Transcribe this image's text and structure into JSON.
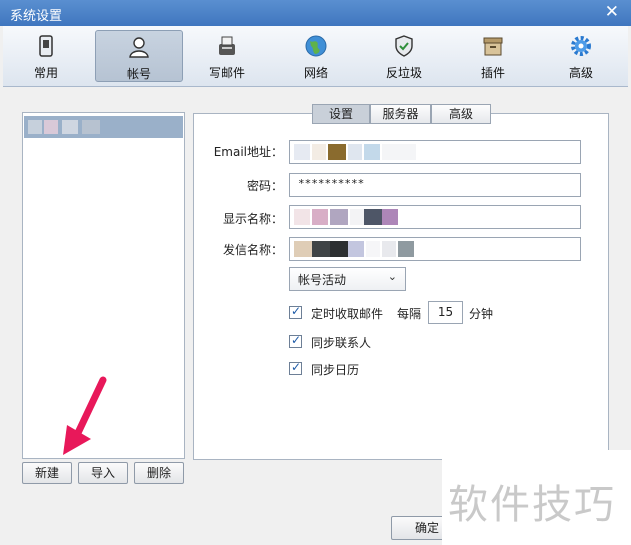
{
  "window": {
    "title": "系统设置",
    "close_symbol": "✕"
  },
  "toolbar": {
    "items": [
      {
        "label": "常用",
        "icon": "phone-icon"
      },
      {
        "label": "帐号",
        "icon": "user-icon"
      },
      {
        "label": "写邮件",
        "icon": "compose-icon"
      },
      {
        "label": "网络",
        "icon": "globe-icon"
      },
      {
        "label": "反垃圾",
        "icon": "shield-icon"
      },
      {
        "label": "插件",
        "icon": "box-icon"
      },
      {
        "label": "高级",
        "icon": "gear-icon"
      }
    ],
    "active": "帐号"
  },
  "account_list": {
    "buttons": {
      "new": "新建",
      "import": "导入",
      "delete": "删除"
    }
  },
  "tabs": [
    {
      "label": "设置"
    },
    {
      "label": "服务器"
    },
    {
      "label": "高级"
    }
  ],
  "form": {
    "email_label": "Email地址：",
    "password_label": "密码：",
    "password_value": "**********",
    "display_name_label": "显示名称：",
    "sender_name_label": "发信名称：",
    "folder_select": "帐号活动",
    "timed_fetch": {
      "label": "定时收取邮件",
      "checked": true,
      "every_label": "每隔",
      "interval": "15",
      "unit": "分钟"
    },
    "sync_contacts": {
      "label": "同步联系人",
      "checked": true
    },
    "sync_calendar": {
      "label": "同步日历",
      "checked": true
    }
  },
  "footer": {
    "ok": "确定"
  },
  "watermark": "软件技巧",
  "colors": {
    "titlebar": "#3f76bf",
    "selection": "#9ab0c9",
    "arrow": "#e8185a"
  }
}
